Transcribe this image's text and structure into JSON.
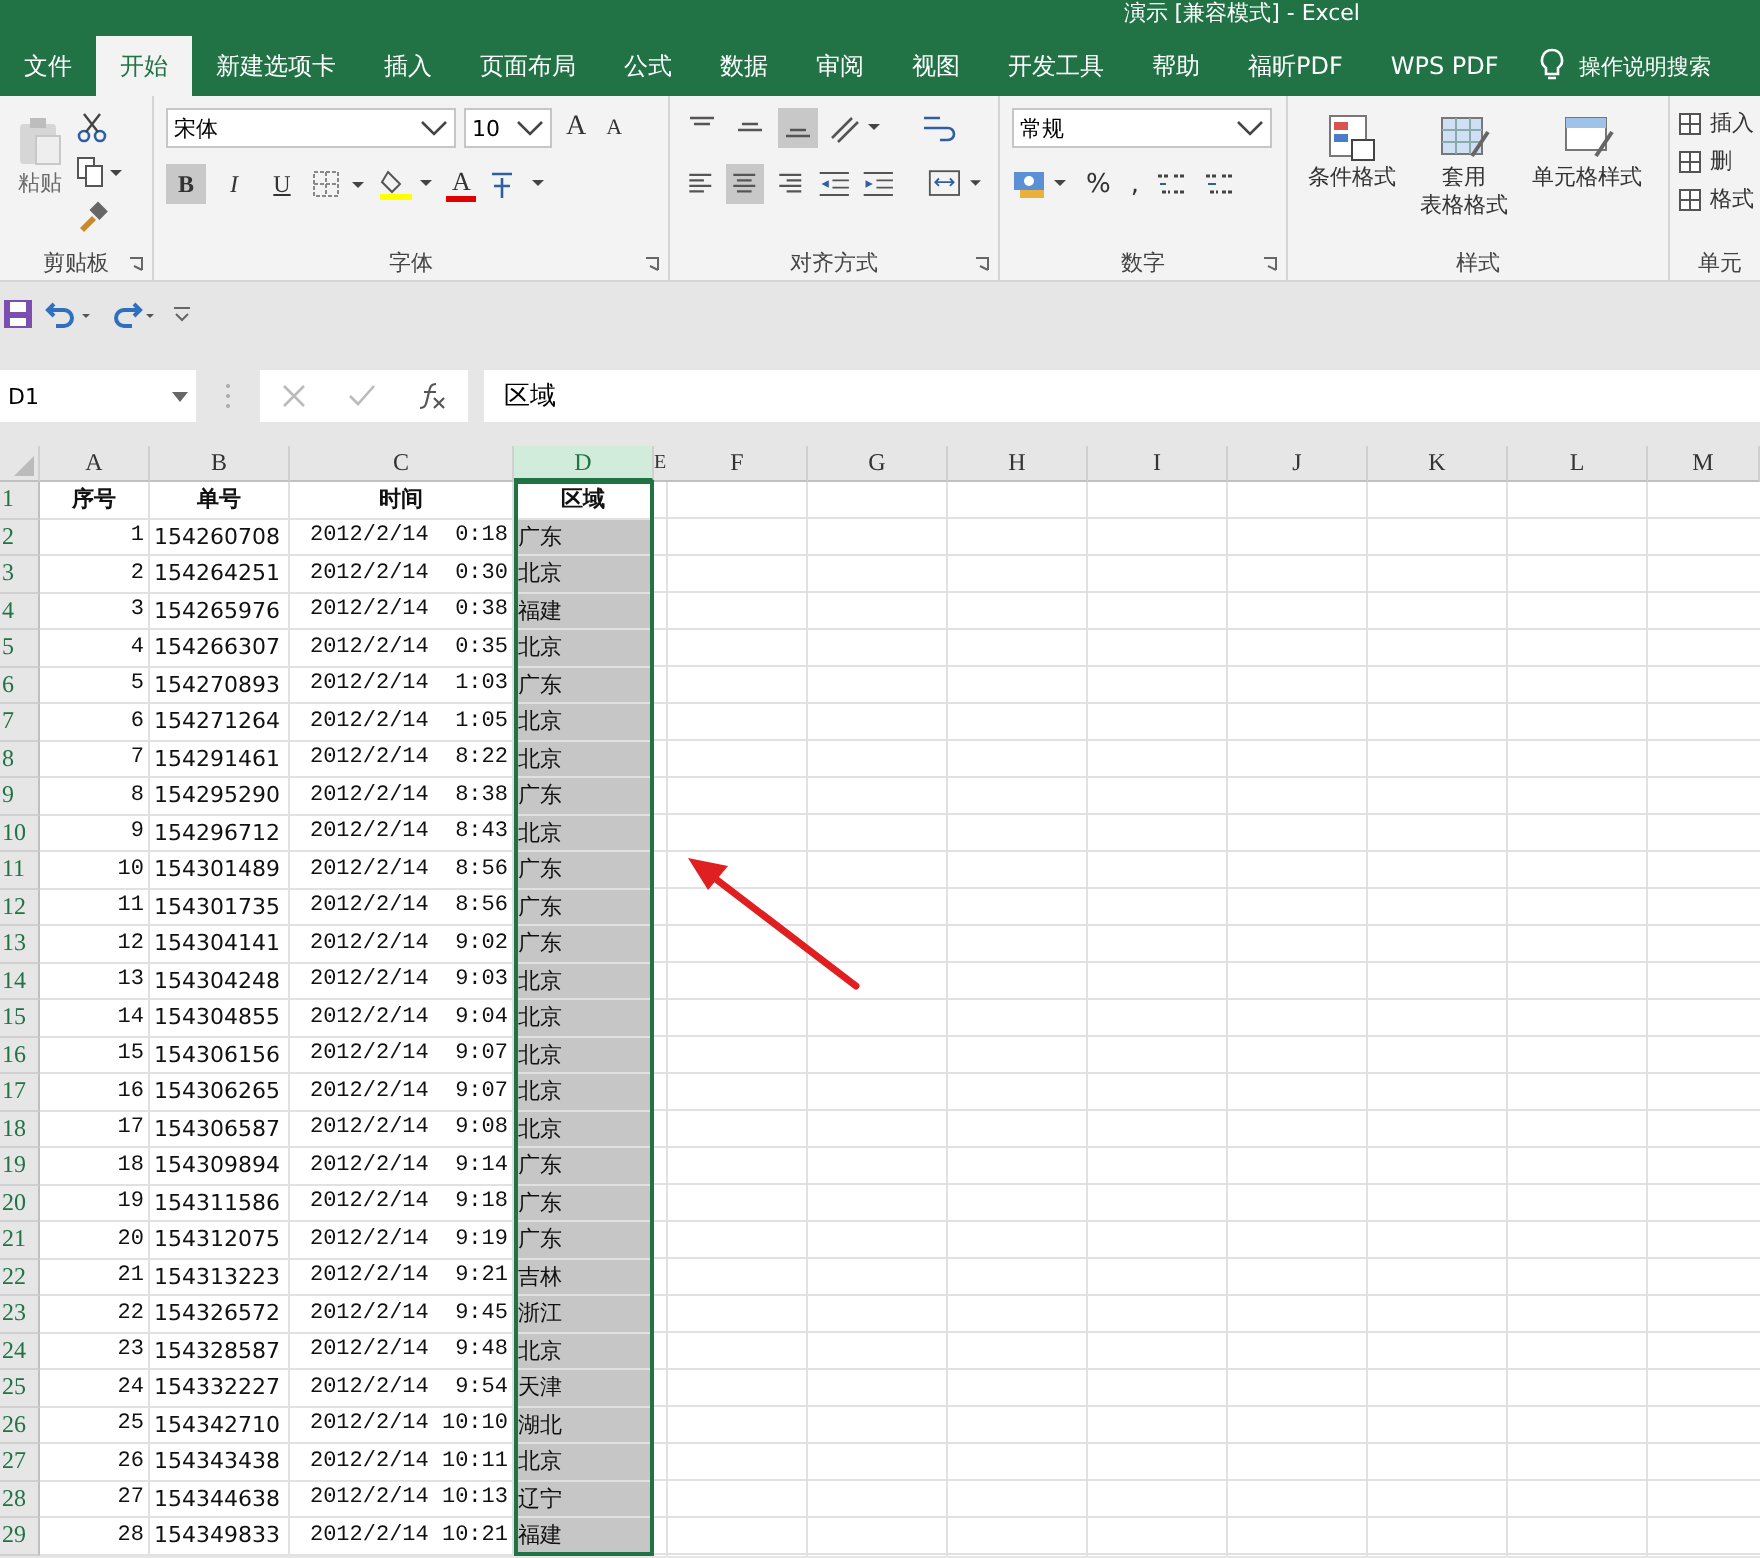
{
  "window": {
    "title": "演示 [兼容模式] - Excel"
  },
  "tabs": [
    {
      "label": "文件",
      "selected": false
    },
    {
      "label": "开始",
      "selected": true
    },
    {
      "label": "新建选项卡",
      "selected": false
    },
    {
      "label": "插入",
      "selected": false
    },
    {
      "label": "页面布局",
      "selected": false
    },
    {
      "label": "公式",
      "selected": false
    },
    {
      "label": "数据",
      "selected": false
    },
    {
      "label": "审阅",
      "selected": false
    },
    {
      "label": "视图",
      "selected": false
    },
    {
      "label": "开发工具",
      "selected": false
    },
    {
      "label": "帮助",
      "selected": false
    },
    {
      "label": "福昕PDF",
      "selected": false
    },
    {
      "label": "WPS PDF",
      "selected": false
    }
  ],
  "tell_me": {
    "placeholder": "操作说明搜索"
  },
  "ribbon": {
    "clipboard": {
      "label": "剪贴板",
      "paste": {
        "label": "粘贴",
        "disabled": true
      }
    },
    "font": {
      "label": "字体",
      "font_name": "宋体",
      "font_size": "10",
      "grow": "A",
      "shrink": "A",
      "toggles": [
        {
          "label": "B",
          "pressed": true
        },
        {
          "label": "I",
          "pressed": false
        },
        {
          "label": "U",
          "pressed": false
        }
      ],
      "font_color_letter": "A"
    },
    "alignment": {
      "label": "对齐方式",
      "vertical": [
        {
          "kind": "top",
          "pressed": false
        },
        {
          "kind": "middle",
          "pressed": false
        },
        {
          "kind": "bottom",
          "pressed": true
        }
      ],
      "horizontal": [
        {
          "kind": "left",
          "pressed": false
        },
        {
          "kind": "center",
          "pressed": true
        },
        {
          "kind": "right",
          "pressed": false
        }
      ]
    },
    "number": {
      "label": "数字",
      "format": "常规",
      "percent": "%",
      "comma": ","
    },
    "styles": {
      "label": "样式",
      "buttons": [
        {
          "kind": "conditional",
          "lines": [
            "条件格式"
          ]
        },
        {
          "kind": "table",
          "lines": [
            "套用",
            "表格格式"
          ]
        },
        {
          "kind": "cell",
          "lines": [
            "单元格样式"
          ]
        }
      ]
    },
    "cells": {
      "label": "单元",
      "buttons": [
        "插入",
        "删",
        "格式"
      ]
    }
  },
  "name_box": {
    "value": "D1"
  },
  "formula": {
    "value": "区域"
  },
  "columns": [
    {
      "label": "A",
      "selected": false
    },
    {
      "label": "B",
      "selected": false
    },
    {
      "label": "C",
      "selected": false
    },
    {
      "label": "D",
      "selected": true
    },
    {
      "label": "E",
      "selected": false
    },
    {
      "label": "F",
      "selected": false
    },
    {
      "label": "G",
      "selected": false
    },
    {
      "label": "H",
      "selected": false
    },
    {
      "label": "I",
      "selected": false
    },
    {
      "label": "J",
      "selected": false
    },
    {
      "label": "K",
      "selected": false
    },
    {
      "label": "L",
      "selected": false
    },
    {
      "label": "M",
      "selected": false
    }
  ],
  "rows": [
    {
      "number": "1",
      "kind": "header",
      "active": true,
      "cells": [
        "序号",
        "单号",
        "时间",
        "区域"
      ]
    },
    {
      "number": "2",
      "kind": "data",
      "active": false,
      "cells": [
        "1",
        "154260708",
        "2012/2/14  0:18",
        "广东"
      ]
    },
    {
      "number": "3",
      "kind": "data",
      "active": false,
      "cells": [
        "2",
        "154264251",
        "2012/2/14  0:30",
        "北京"
      ]
    },
    {
      "number": "4",
      "kind": "data",
      "active": false,
      "cells": [
        "3",
        "154265976",
        "2012/2/14  0:38",
        "福建"
      ]
    },
    {
      "number": "5",
      "kind": "data",
      "active": false,
      "cells": [
        "4",
        "154266307",
        "2012/2/14  0:35",
        "北京"
      ]
    },
    {
      "number": "6",
      "kind": "data",
      "active": false,
      "cells": [
        "5",
        "154270893",
        "2012/2/14  1:03",
        "广东"
      ]
    },
    {
      "number": "7",
      "kind": "data",
      "active": false,
      "cells": [
        "6",
        "154271264",
        "2012/2/14  1:05",
        "北京"
      ]
    },
    {
      "number": "8",
      "kind": "data",
      "active": false,
      "cells": [
        "7",
        "154291461",
        "2012/2/14  8:22",
        "北京"
      ]
    },
    {
      "number": "9",
      "kind": "data",
      "active": false,
      "cells": [
        "8",
        "154295290",
        "2012/2/14  8:38",
        "广东"
      ]
    },
    {
      "number": "10",
      "kind": "data",
      "active": false,
      "cells": [
        "9",
        "154296712",
        "2012/2/14  8:43",
        "北京"
      ]
    },
    {
      "number": "11",
      "kind": "data",
      "active": false,
      "cells": [
        "10",
        "154301489",
        "2012/2/14  8:56",
        "广东"
      ]
    },
    {
      "number": "12",
      "kind": "data",
      "active": false,
      "cells": [
        "11",
        "154301735",
        "2012/2/14  8:56",
        "广东"
      ]
    },
    {
      "number": "13",
      "kind": "data",
      "active": false,
      "cells": [
        "12",
        "154304141",
        "2012/2/14  9:02",
        "广东"
      ]
    },
    {
      "number": "14",
      "kind": "data",
      "active": false,
      "cells": [
        "13",
        "154304248",
        "2012/2/14  9:03",
        "北京"
      ]
    },
    {
      "number": "15",
      "kind": "data",
      "active": false,
      "cells": [
        "14",
        "154304855",
        "2012/2/14  9:04",
        "北京"
      ]
    },
    {
      "number": "16",
      "kind": "data",
      "active": false,
      "cells": [
        "15",
        "154306156",
        "2012/2/14  9:07",
        "北京"
      ]
    },
    {
      "number": "17",
      "kind": "data",
      "active": false,
      "cells": [
        "16",
        "154306265",
        "2012/2/14  9:07",
        "北京"
      ]
    },
    {
      "number": "18",
      "kind": "data",
      "active": false,
      "cells": [
        "17",
        "154306587",
        "2012/2/14  9:08",
        "北京"
      ]
    },
    {
      "number": "19",
      "kind": "data",
      "active": false,
      "cells": [
        "18",
        "154309894",
        "2012/2/14  9:14",
        "广东"
      ]
    },
    {
      "number": "20",
      "kind": "data",
      "active": false,
      "cells": [
        "19",
        "154311586",
        "2012/2/14  9:18",
        "广东"
      ]
    },
    {
      "number": "21",
      "kind": "data",
      "active": false,
      "cells": [
        "20",
        "154312075",
        "2012/2/14  9:19",
        "广东"
      ]
    },
    {
      "number": "22",
      "kind": "data",
      "active": false,
      "cells": [
        "21",
        "154313223",
        "2012/2/14  9:21",
        "吉林"
      ]
    },
    {
      "number": "23",
      "kind": "data",
      "active": false,
      "cells": [
        "22",
        "154326572",
        "2012/2/14  9:45",
        "浙江"
      ]
    },
    {
      "number": "24",
      "kind": "data",
      "active": false,
      "cells": [
        "23",
        "154328587",
        "2012/2/14  9:48",
        "北京"
      ]
    },
    {
      "number": "25",
      "kind": "data",
      "active": false,
      "cells": [
        "24",
        "154332227",
        "2012/2/14  9:54",
        "天津"
      ]
    },
    {
      "number": "26",
      "kind": "data",
      "active": false,
      "cells": [
        "25",
        "154342710",
        "2012/2/14 10:10",
        "湖北"
      ]
    },
    {
      "number": "27",
      "kind": "data",
      "active": false,
      "cells": [
        "26",
        "154343438",
        "2012/2/14 10:11",
        "北京"
      ]
    },
    {
      "number": "28",
      "kind": "data",
      "active": false,
      "cells": [
        "27",
        "154344638",
        "2012/2/14 10:13",
        "辽宁"
      ]
    },
    {
      "number": "29",
      "kind": "data",
      "active": false,
      "cells": [
        "28",
        "154349833",
        "2012/2/14 10:21",
        "福建"
      ]
    }
  ]
}
